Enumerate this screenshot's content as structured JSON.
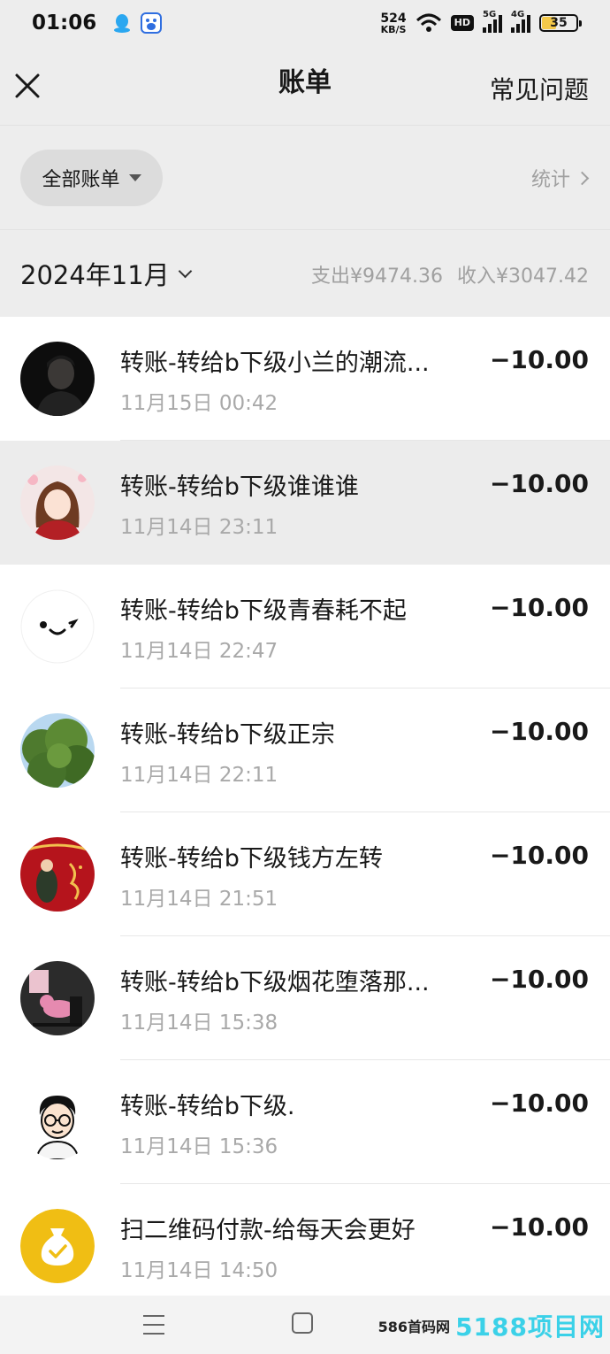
{
  "status_bar": {
    "time": "01:06",
    "net_speed_value": "524",
    "net_speed_unit": "KB/S",
    "hd_label": "HD",
    "signal1_label": "5G",
    "signal2_label": "4G",
    "battery_level": "35",
    "left_icons": [
      "qq-icon",
      "baidu-icon"
    ]
  },
  "header": {
    "title": "账单",
    "faq_label": "常见问题"
  },
  "filter": {
    "selected": "全部账单",
    "stats_label": "统计"
  },
  "month_bar": {
    "month": "2024年11月",
    "expense": "支出¥9474.36",
    "income": "收入¥3047.42"
  },
  "transactions": [
    {
      "description": "转账-转给b下级小兰的潮流...",
      "time": "11月15日 00:42",
      "amount": "−10.00",
      "avatar": "dark-portrait"
    },
    {
      "description": "转账-转给b下级谁谁谁",
      "time": "11月14日 23:11",
      "amount": "−10.00",
      "avatar": "anime-girl"
    },
    {
      "description": "转账-转给b下级青春耗不起",
      "time": "11月14日 22:47",
      "amount": "−10.00",
      "avatar": "smiley-face"
    },
    {
      "description": "转账-转给b下级正宗",
      "time": "11月14日 22:11",
      "amount": "−10.00",
      "avatar": "green-tree"
    },
    {
      "description": "转账-转给b下级钱方左转",
      "time": "11月14日 21:51",
      "amount": "−10.00",
      "avatar": "red-festive"
    },
    {
      "description": "转账-转给b下级烟花堕落那...",
      "time": "11月14日 15:38",
      "amount": "−10.00",
      "avatar": "dark-cartoon"
    },
    {
      "description": "转账-转给b下级.",
      "time": "11月14日 15:36",
      "amount": "−10.00",
      "avatar": "glasses-cartoon"
    },
    {
      "description": "扫二维码付款-给每天会更好",
      "time": "11月14日 14:50",
      "amount": "−10.00",
      "avatar": "yellow-money-bag"
    }
  ],
  "bottom_nav": {
    "watermark_a": "586首码网",
    "watermark_b": "5188项目网"
  },
  "colors": {
    "background": "#ededed",
    "list_bg": "#ffffff",
    "highlight_row": "#ececec",
    "muted_text": "#a9a9a9",
    "coin_yellow": "#f0be14"
  }
}
